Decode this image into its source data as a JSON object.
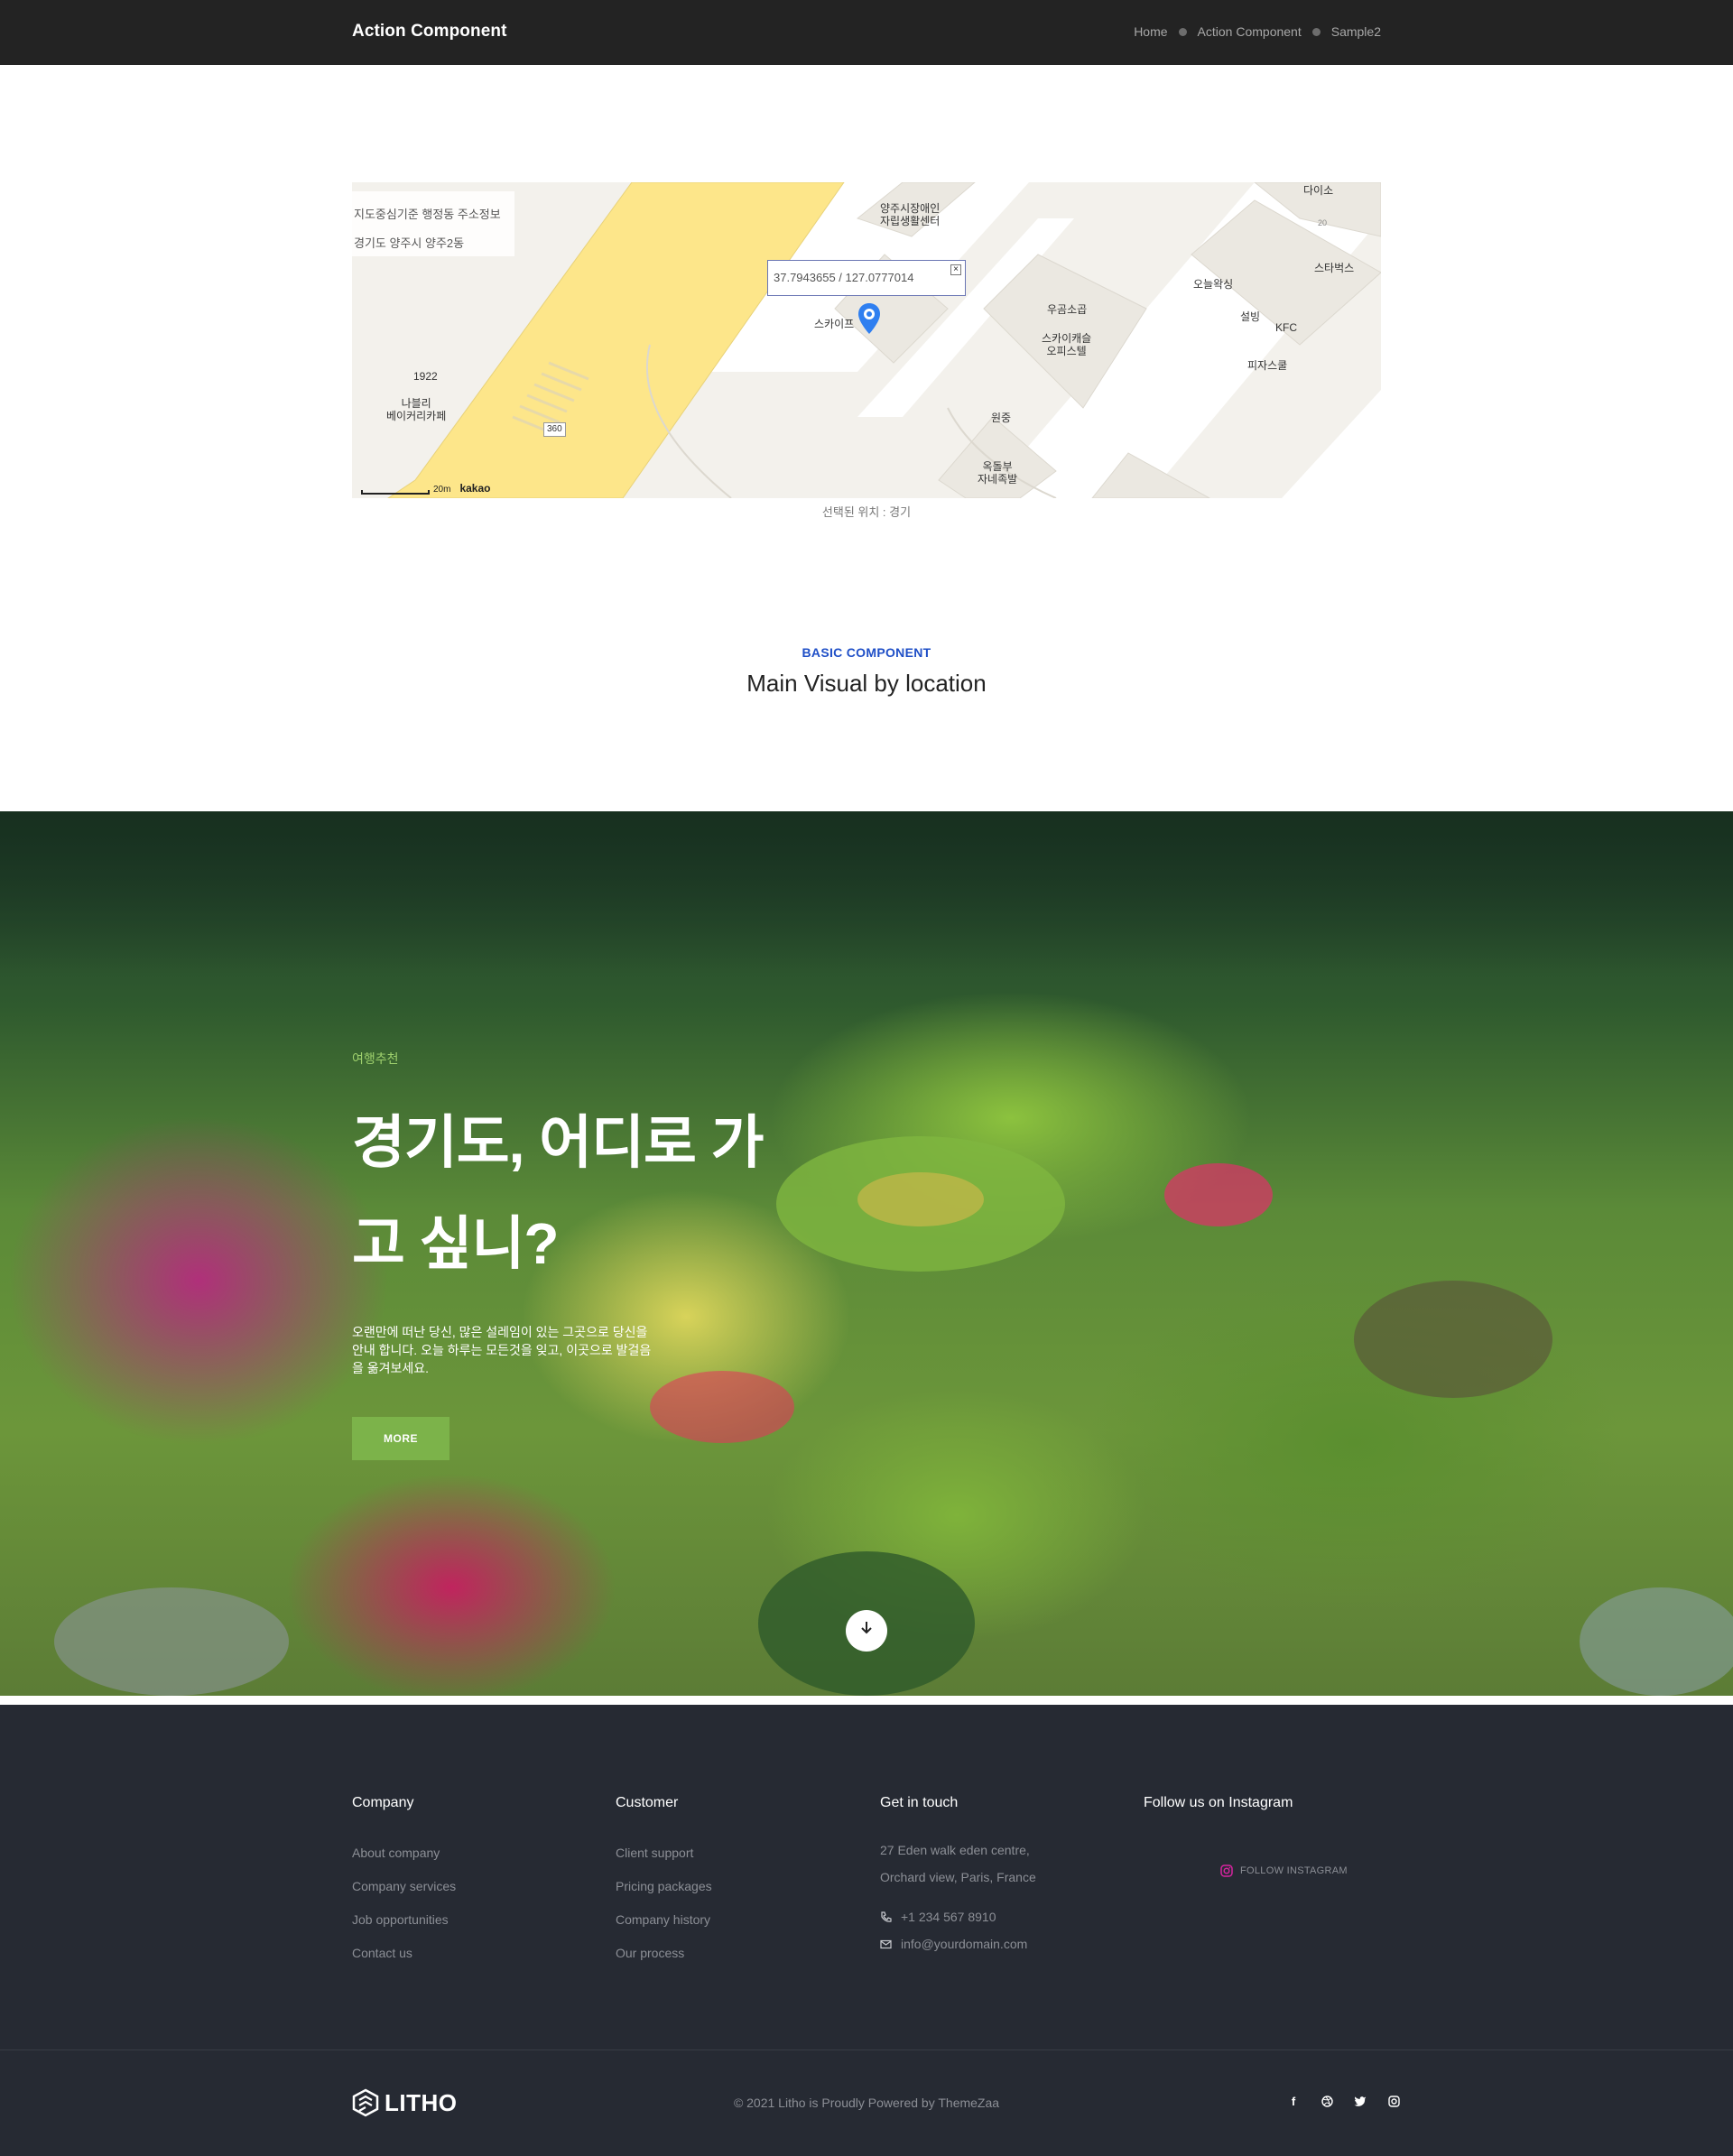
{
  "header": {
    "brand": "Action Component",
    "breadcrumbs": [
      "Home",
      "Action Component",
      "Sample2"
    ]
  },
  "map": {
    "address_title": "지도중심기준 행정동 주소정보",
    "address_value": "경기도 양주시 양주2동",
    "coordinates": "37.7943655 / 127.0777014",
    "close_glyph": "×",
    "scale_label": "20m",
    "provider": "kakao",
    "road_number": "360",
    "labels": {
      "bakery": "나블리\n베이커리카페",
      "bakery_num": "1922",
      "self_reliance": "양주시장애인\n자립생활센터",
      "skypalace": "스카이프",
      "daiso": "다이소",
      "daiso_num": "20",
      "starbucks": "스타벅스",
      "today": "오늘왁싱",
      "sulbing": "설빙",
      "kfc": "KFC",
      "pizza": "피자스쿨",
      "woogom": "우곰소곱",
      "officetel": "스카이캐슬\n오피스텔",
      "wonjung": "원중",
      "okdol": "옥돌부\n자네족발"
    },
    "caption": "선택된 위치 : 경기"
  },
  "section": {
    "eyebrow": "BASIC COMPONENT",
    "title": "Main Visual by location"
  },
  "hero": {
    "kicker": "여행추천",
    "title": "경기도, 어디로 가고 싶니?",
    "description": "오랜만에 떠난 당신, 많은 설레임이 있는 그곳으로 당신을 안내 합니다. 오늘 하루는 모든것을 잊고, 이곳으로 발걸음을 옮겨보세요.",
    "button": "MORE"
  },
  "footer": {
    "company": {
      "heading": "Company",
      "links": [
        "About company",
        "Company services",
        "Job opportunities",
        "Contact us"
      ]
    },
    "customer": {
      "heading": "Customer",
      "links": [
        "Client support",
        "Pricing packages",
        "Company history",
        "Our process"
      ]
    },
    "contact": {
      "heading": "Get in touch",
      "address_line1": "27 Eden walk eden centre,",
      "address_line2": "Orchard view, Paris, France",
      "phone": "+1 234 567 8910",
      "email": "info@yourdomain.com"
    },
    "instagram": {
      "heading": "Follow us on Instagram",
      "link": "FOLLOW INSTAGRAM"
    },
    "logo_text": "LITHO",
    "copyright": "© 2021 Litho is Proudly Powered by ThemeZaa",
    "social_icons": [
      "facebook-icon",
      "dribbble-icon",
      "twitter-icon",
      "instagram-icon"
    ]
  },
  "colors": {
    "header_bg": "#232323",
    "accent_blue": "#1f4fc7",
    "button_green": "#7cb34a",
    "footer_bg": "#262a33",
    "road_yellow": "#fde68a"
  }
}
